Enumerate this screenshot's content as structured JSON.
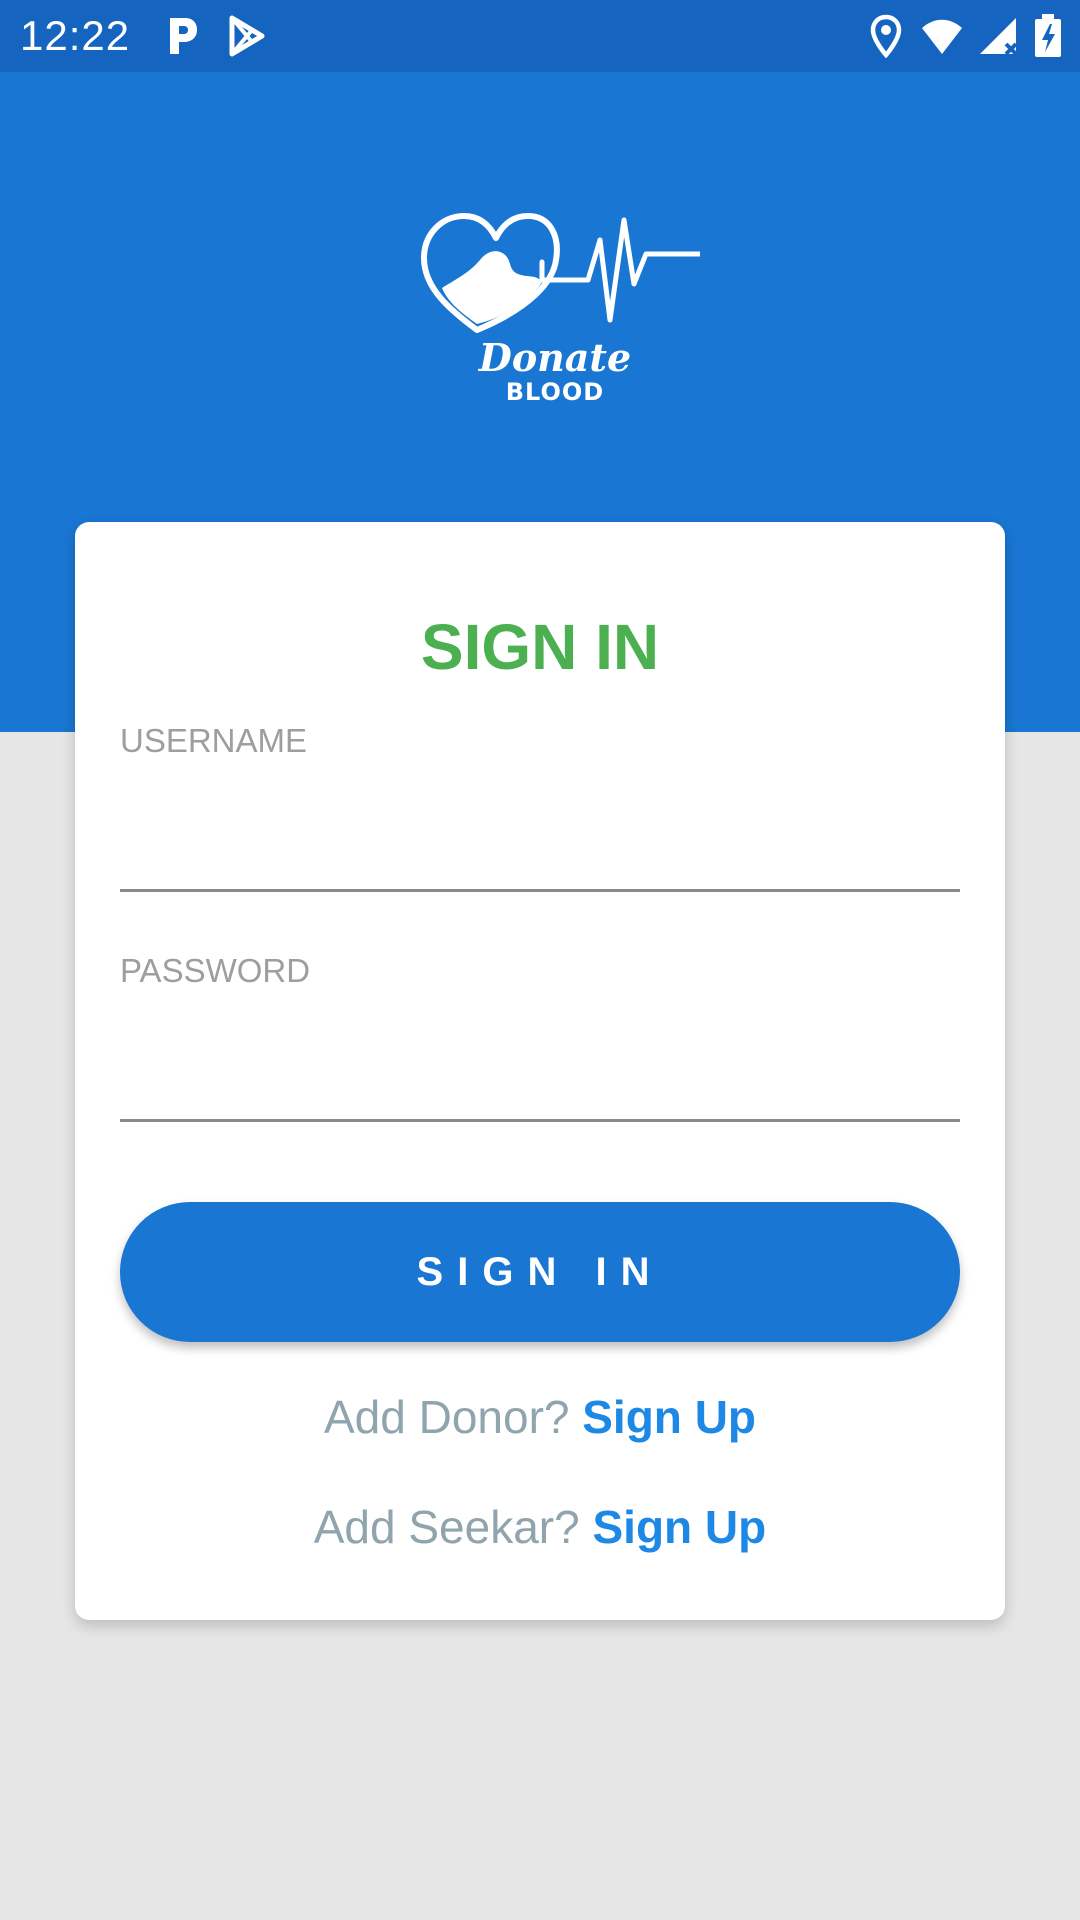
{
  "status_bar": {
    "time": "12:22",
    "icons": [
      "parking-icon",
      "play-store-icon",
      "location-icon",
      "wifi-icon",
      "cell-signal-icon",
      "battery-charging-icon"
    ]
  },
  "logo": {
    "line1": "Donate",
    "line2": "BLOOD"
  },
  "form": {
    "title": "SIGN IN",
    "username_label": "USERNAME",
    "username_value": "",
    "password_label": "PASSWORD",
    "password_value": "",
    "submit_label": "SIGN IN"
  },
  "links": {
    "donor_prompt": "Add Donor?",
    "donor_link": "Sign Up",
    "seeker_prompt": "Add Seekar?",
    "seeker_link": "Sign Up"
  },
  "colors": {
    "header_blue": "#1976d2",
    "status_blue": "#1565c0",
    "title_green": "#4caf50",
    "link_blue": "#1e88e5",
    "background": "#e6e6e6"
  }
}
